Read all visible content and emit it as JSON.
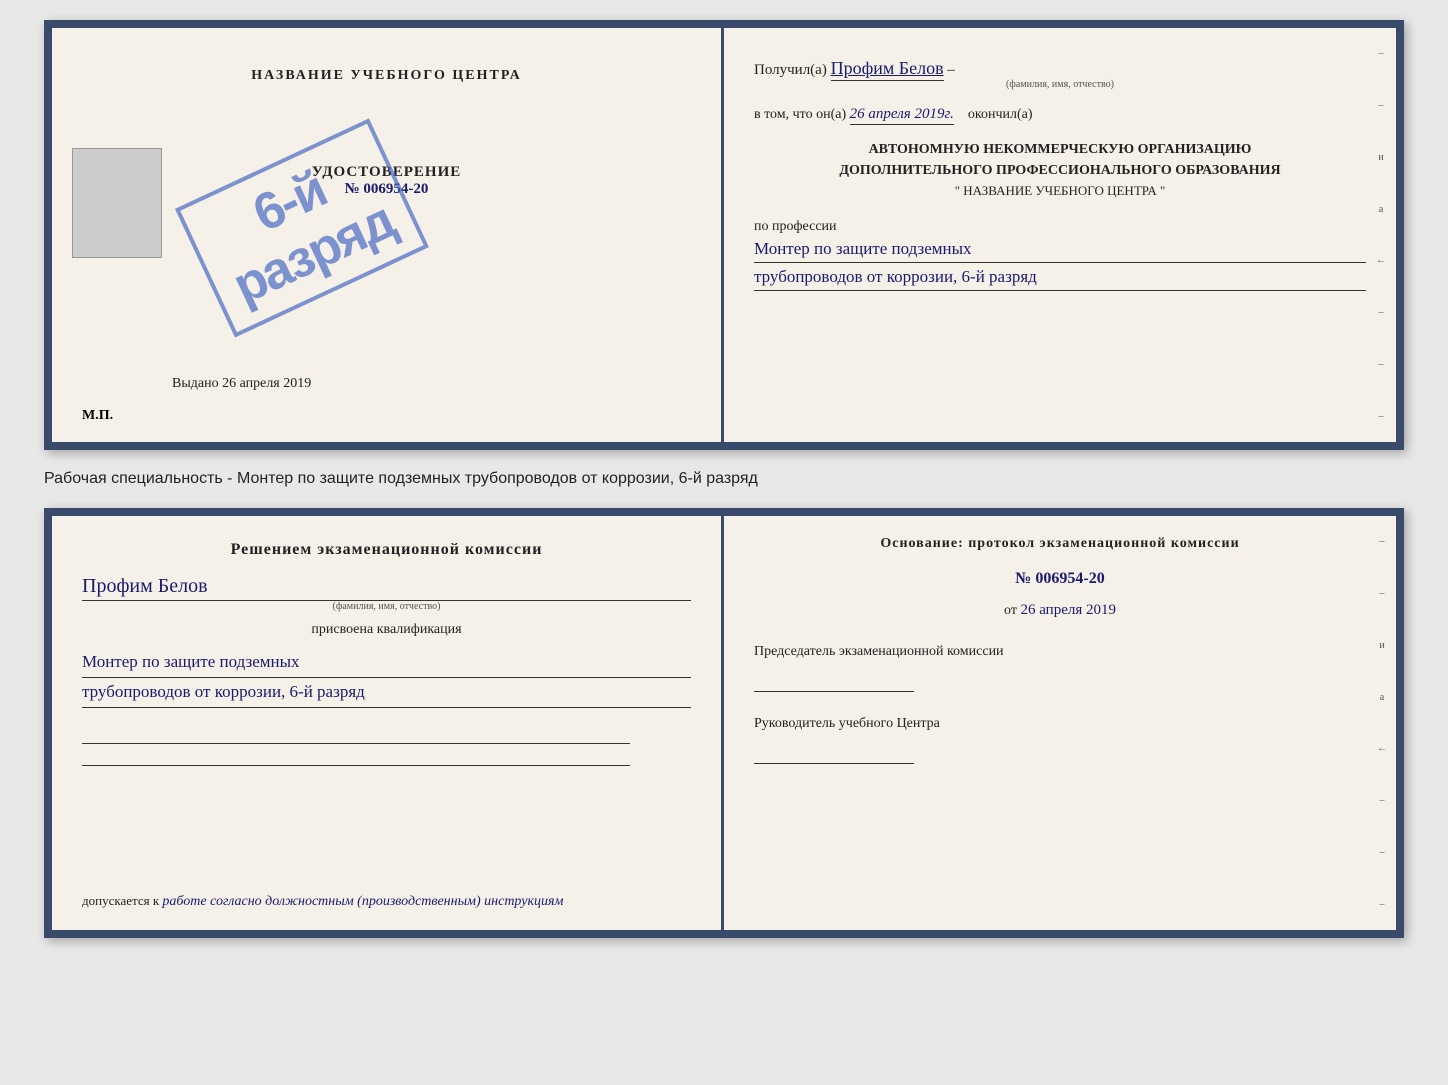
{
  "topCert": {
    "left": {
      "schoolNameLabel": "НАЗВАНИЕ УЧЕБНОГО ЦЕНТРА",
      "udostoverenie": "УДОСТОВЕРЕНИЕ",
      "number": "№ 006954-20",
      "stampLine1": "6-й",
      "stampLine2": "разряд",
      "vydanoLabel": "Выдано",
      "vydanoDate": "26 апреля 2019",
      "mp": "М.П."
    },
    "right": {
      "poluchilLabel": "Получил(а)",
      "fio": "Профим Белов",
      "fioSubLabel": "(фамилия, имя, отчество)",
      "dashAfterFio": "–",
      "vtomLabel": "в том, что он(а)",
      "date": "26 апреля 2019г.",
      "okonchilLabel": "окончил(а)",
      "orgLine1": "АВТОНОМНУЮ НЕКОММЕРЧЕСКУЮ ОРГАНИЗАЦИЮ",
      "orgLine2": "ДОПОЛНИТЕЛЬНОГО ПРОФЕССИОНАЛЬНОГО ОБРАЗОВАНИЯ",
      "orgLine3": "\"   НАЗВАНИЕ УЧЕБНОГО ЦЕНТРА   \"",
      "poProf": "по профессии",
      "profession1": "Монтер по защите подземных",
      "profession2": "трубопроводов от коррозии, 6-й разряд",
      "sideMarks": [
        "–",
        "–",
        "и",
        "а",
        "←",
        "–",
        "–",
        "–"
      ]
    }
  },
  "workingSpecialty": {
    "text": "Рабочая специальность - Монтер по защите подземных трубопроводов от коррозии, 6-й разряд"
  },
  "bottomCert": {
    "left": {
      "resheniemTitle": "Решением экзаменационной комиссии",
      "fio": "Профим Белов",
      "fioSubLabel": "(фамилия, имя, отчество)",
      "prisvoena": "присвоена квалификация",
      "kvalif1": "Монтер по защите подземных",
      "kvalif2": "трубопроводов от коррозии, 6-й разряд",
      "dopuskaetsyaLabel": "допускается к",
      "dopuskaetsyaValue": "работе согласно должностным (производственным) инструкциям"
    },
    "right": {
      "osnovanie": "Основание: протокол экзаменационной комиссии",
      "protocolNum": "№  006954-20",
      "otLabel": "от",
      "otDate": "26 апреля 2019",
      "predsedatelTitle": "Председатель экзаменационной комиссии",
      "rukovoditelTitle": "Руководитель учебного Центра",
      "sideMarks": [
        "–",
        "–",
        "и",
        "а",
        "←",
        "–",
        "–",
        "–"
      ]
    }
  }
}
